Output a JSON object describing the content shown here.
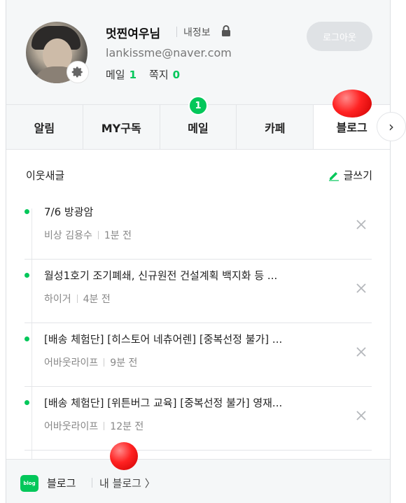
{
  "profile": {
    "nickname": "멋찐여우님",
    "my_info_label": "내정보",
    "email": "lankissme@naver.com",
    "mail_label": "메일",
    "mail_count": "1",
    "note_label": "쪽지",
    "note_count": "0",
    "logout_label": "로그아웃"
  },
  "tabs": [
    {
      "label": "알림"
    },
    {
      "label": "MY구독"
    },
    {
      "label": "메일",
      "badge": "1"
    },
    {
      "label": "카페"
    },
    {
      "label": "블로그"
    }
  ],
  "feed": {
    "title": "이웃새글",
    "write_label": "글쓰기",
    "items": [
      {
        "title": "7/6 방광암",
        "author": "비상 김용수",
        "time": "1분 전"
      },
      {
        "title": "월성1호기 조기폐쇄, 신규원전 건설계획 백지화 등 ...",
        "author": "하이거",
        "time": "4분 전"
      },
      {
        "title": "[배송 체험단] [히스토어 네츄어렌] [중복선정 불가] ...",
        "author": "어바웃라이프",
        "time": "9분 전"
      },
      {
        "title": "[배송 체험단] [위튼버그 교육] [중복선정 불가] 영재...",
        "author": "어바웃라이프",
        "time": "12분 전"
      }
    ]
  },
  "footer": {
    "icon_text": "blog",
    "blog_label": "블로그",
    "my_blog_label": "내 블로그 〉"
  },
  "colors": {
    "accent": "#03c75a",
    "panel_bg": "#f5f7f8"
  },
  "icons": {
    "settings": "gear-icon",
    "lock": "lock-icon",
    "write": "pencil-icon",
    "close": "close-icon",
    "next": "chevron-right-icon"
  }
}
